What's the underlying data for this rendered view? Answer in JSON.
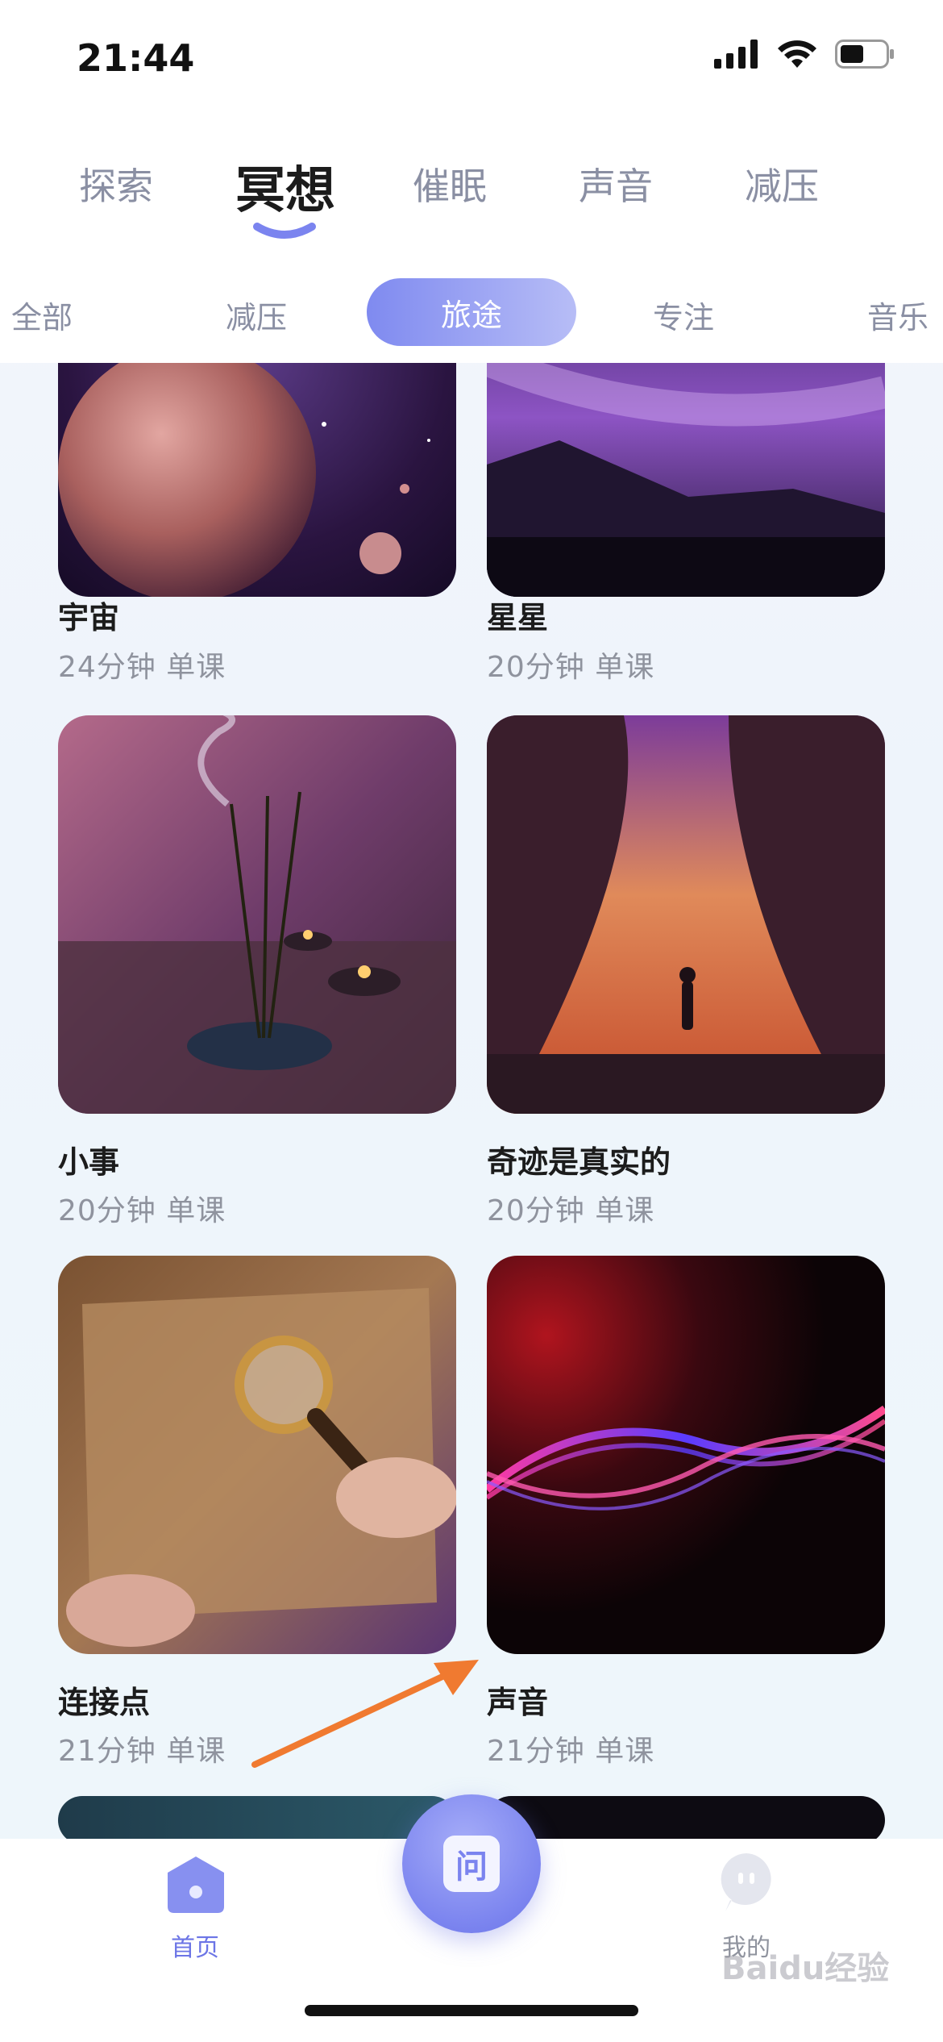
{
  "status_bar": {
    "time": "21:44"
  },
  "top_tabs": [
    {
      "label": "探索"
    },
    {
      "label": "冥想",
      "active": true
    },
    {
      "label": "催眠"
    },
    {
      "label": "声音"
    },
    {
      "label": "减压"
    }
  ],
  "sub_tabs": [
    {
      "label": "全部"
    },
    {
      "label": "减压"
    },
    {
      "label": "旅途",
      "active": true
    },
    {
      "label": "专注"
    },
    {
      "label": "音乐"
    }
  ],
  "cards": [
    {
      "title": "宇宙",
      "meta": "24分钟 单课"
    },
    {
      "title": "星星",
      "meta": "20分钟 单课"
    },
    {
      "title": "小事",
      "meta": "20分钟 单课"
    },
    {
      "title": "奇迹是真实的",
      "meta": "20分钟 单课"
    },
    {
      "title": "连接点",
      "meta": "21分钟 单课"
    },
    {
      "title": "声音",
      "meta": "21分钟 单课"
    }
  ],
  "tab_bar": {
    "home_label": "首页",
    "center_glyph": "问",
    "me_label": "我的"
  },
  "watermark": "Baidu经验",
  "colors": {
    "accent": "#7b84ef",
    "arrow": "#f07a30"
  }
}
